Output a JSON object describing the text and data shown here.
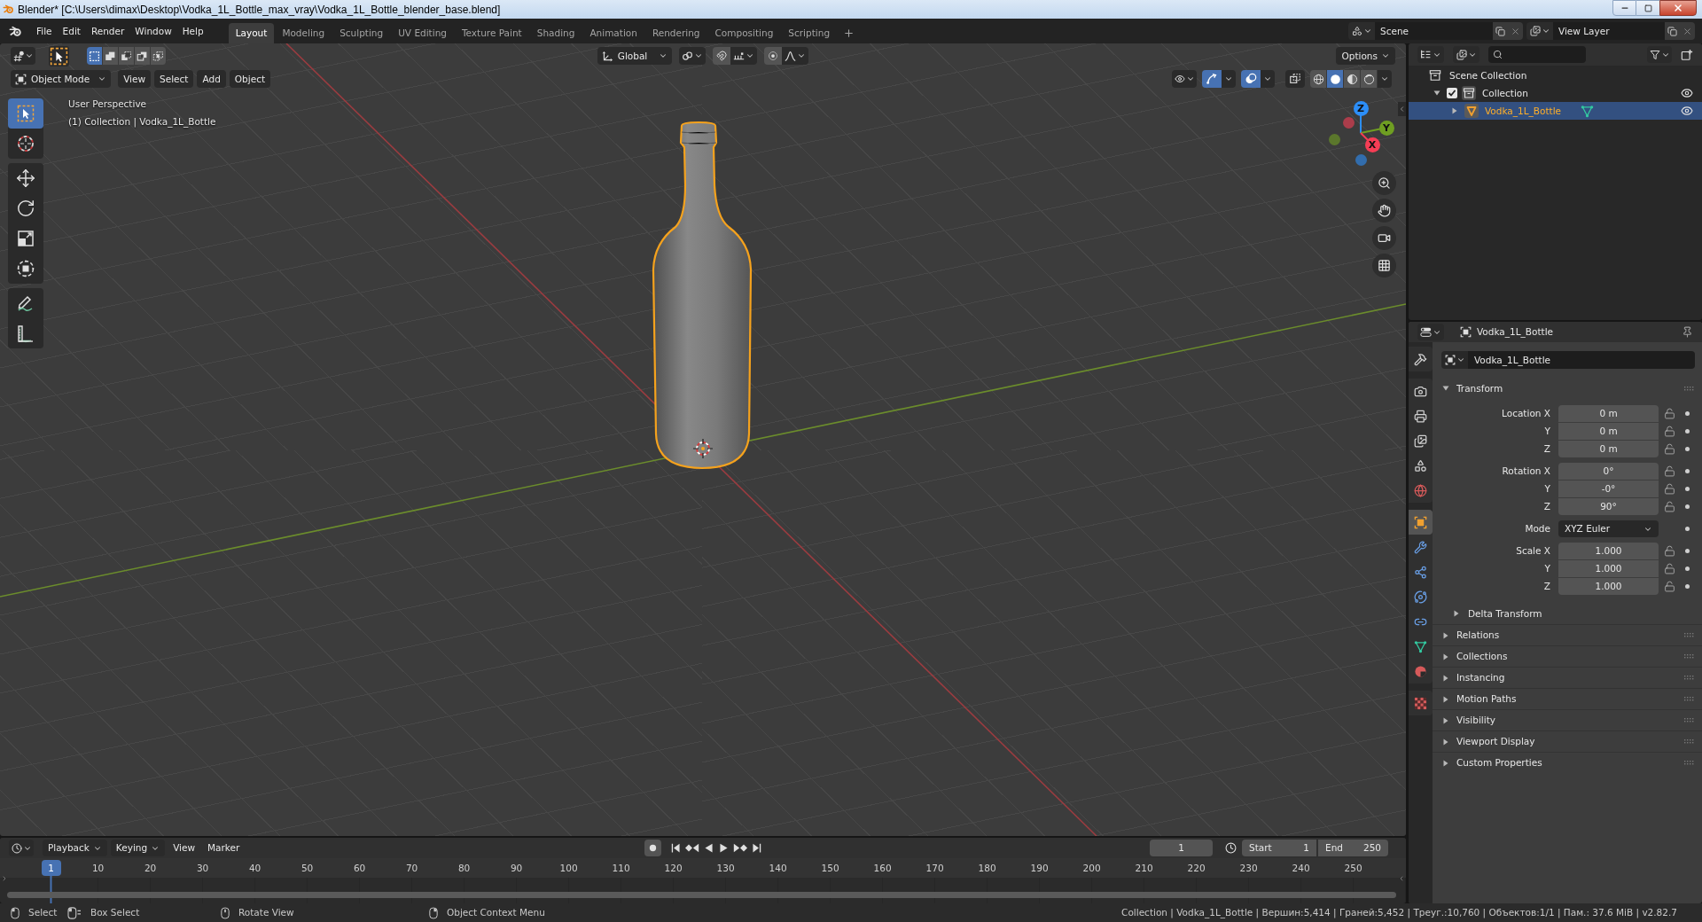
{
  "window": {
    "title": "Blender* [C:\\Users\\dimax\\Desktop\\Vodka_1L_Bottle_max_vray\\Vodka_1L_Bottle_blender_base.blend]"
  },
  "top_bar": {
    "menus": [
      "File",
      "Edit",
      "Render",
      "Window",
      "Help"
    ],
    "workspaces": [
      {
        "label": "Layout",
        "selected": true
      },
      {
        "label": "Modeling",
        "selected": false
      },
      {
        "label": "Sculpting",
        "selected": false
      },
      {
        "label": "UV Editing",
        "selected": false
      },
      {
        "label": "Texture Paint",
        "selected": false
      },
      {
        "label": "Shading",
        "selected": false
      },
      {
        "label": "Animation",
        "selected": false
      },
      {
        "label": "Rendering",
        "selected": false
      },
      {
        "label": "Compositing",
        "selected": false
      },
      {
        "label": "Scripting",
        "selected": false
      }
    ],
    "scene": "Scene",
    "view_layer": "View Layer"
  },
  "viewport": {
    "tool_header": {
      "select_modes": [
        {
          "kind": "set",
          "selected": true
        },
        {
          "kind": "extend",
          "selected": false
        },
        {
          "kind": "subtract",
          "selected": false
        },
        {
          "kind": "invert",
          "selected": false
        },
        {
          "kind": "intersect",
          "selected": false
        }
      ],
      "orientation": "Global",
      "options": "Options"
    },
    "header": {
      "mode": "Object Mode",
      "menus": [
        "View",
        "Select",
        "Add",
        "Object"
      ],
      "toggles": [
        {
          "kind": "gizmo",
          "on": true
        },
        {
          "kind": "overlay",
          "on": true
        },
        {
          "kind": "xray",
          "on": false
        }
      ],
      "shading": [
        {
          "kind": "wireframe",
          "selected": false
        },
        {
          "kind": "solid",
          "selected": true
        },
        {
          "kind": "material",
          "selected": false
        },
        {
          "kind": "rendered",
          "selected": false
        }
      ]
    },
    "tool_groups": [
      {
        "tools": [
          {
            "kind": "select_box",
            "selected": true
          },
          {
            "kind": "cursor",
            "selected": false
          }
        ]
      },
      {
        "tools": [
          {
            "kind": "move",
            "selected": false
          },
          {
            "kind": "rotate",
            "selected": false
          },
          {
            "kind": "scale",
            "selected": false
          },
          {
            "kind": "transform",
            "selected": false
          }
        ]
      },
      {
        "tools": [
          {
            "kind": "annotate",
            "selected": false
          },
          {
            "kind": "measure",
            "selected": false
          }
        ]
      }
    ],
    "info": [
      "User Perspective",
      "(1) Collection | Vodka_1L_Bottle"
    ],
    "axes": [
      {
        "label": "Z",
        "color": "#2c8ef8"
      },
      {
        "label": "Y",
        "color": "#6f9e22"
      },
      {
        "label": "X",
        "color": "#f53d55"
      }
    ],
    "object": {
      "selected": true
    }
  },
  "outliner": {
    "tree": [
      {
        "kind": "scene_collection",
        "label": "Scene Collection",
        "selected": false,
        "children": [
          {
            "kind": "collection",
            "label": "Collection",
            "selected": false,
            "expanded": true,
            "checked": true,
            "visible": true,
            "children": [
              {
                "kind": "object",
                "label": "Vodka_1L_Bottle",
                "selected": true,
                "expanded": false,
                "visible": true
              }
            ]
          }
        ]
      }
    ]
  },
  "properties": {
    "title": "Vodka_1L_Bottle",
    "tab_groups": [
      {
        "tabs": [
          {
            "kind": "tool",
            "selected": false
          }
        ]
      },
      {
        "tabs": [
          {
            "kind": "render",
            "selected": false
          },
          {
            "kind": "output",
            "selected": false
          },
          {
            "kind": "view_layer",
            "selected": false
          },
          {
            "kind": "scene",
            "selected": false
          },
          {
            "kind": "world",
            "selected": false
          }
        ]
      },
      {
        "tabs": [
          {
            "kind": "object",
            "selected": true
          },
          {
            "kind": "modifiers",
            "selected": false
          },
          {
            "kind": "particles",
            "selected": false
          },
          {
            "kind": "physics",
            "selected": false
          },
          {
            "kind": "constraints",
            "selected": false
          },
          {
            "kind": "data",
            "selected": false
          },
          {
            "kind": "material",
            "selected": false
          }
        ]
      },
      {
        "tabs": [
          {
            "kind": "texture",
            "selected": false
          }
        ]
      }
    ],
    "name": "Vodka_1L_Bottle",
    "transform": {
      "title": "Transform",
      "expanded": true,
      "groups": [
        {
          "rows": [
            {
              "kind": "number",
              "label": "Location X",
              "value": "0 m"
            },
            {
              "kind": "number",
              "label": "Y",
              "value": "0 m"
            },
            {
              "kind": "number",
              "label": "Z",
              "value": "0 m"
            }
          ]
        },
        {
          "rows": [
            {
              "kind": "number",
              "label": "Rotation X",
              "value": "0°"
            },
            {
              "kind": "number",
              "label": "Y",
              "value": "-0°"
            },
            {
              "kind": "number",
              "label": "Z",
              "value": "90°"
            }
          ]
        },
        {
          "rows": [
            {
              "kind": "dropdown",
              "label": "Mode",
              "value": "XYZ Euler"
            }
          ]
        },
        {
          "rows": [
            {
              "kind": "number",
              "label": "Scale X",
              "value": "1.000"
            },
            {
              "kind": "number",
              "label": "Y",
              "value": "1.000"
            },
            {
              "kind": "number",
              "label": "Z",
              "value": "1.000"
            }
          ]
        }
      ],
      "subpanels": [
        {
          "title": "Delta Transform",
          "expanded": false
        }
      ]
    },
    "panels": [
      {
        "title": "Relations",
        "expanded": false
      },
      {
        "title": "Collections",
        "expanded": false
      },
      {
        "title": "Instancing",
        "expanded": false
      },
      {
        "title": "Motion Paths",
        "expanded": false
      },
      {
        "title": "Visibility",
        "expanded": false
      },
      {
        "title": "Viewport Display",
        "expanded": false
      },
      {
        "title": "Custom Properties",
        "expanded": false
      }
    ]
  },
  "timeline": {
    "menus": [
      {
        "kind": "dropdown",
        "label": "Playback"
      },
      {
        "kind": "dropdown",
        "label": "Keying"
      },
      {
        "kind": "menu",
        "label": "View"
      },
      {
        "kind": "menu",
        "label": "Marker"
      }
    ],
    "current_frame": "1",
    "start": {
      "label": "Start",
      "value": "1"
    },
    "end": {
      "label": "End",
      "value": "250"
    },
    "playhead": "1",
    "ruler": [
      "10",
      "20",
      "30",
      "40",
      "50",
      "60",
      "70",
      "80",
      "90",
      "100",
      "110",
      "120",
      "130",
      "140",
      "150",
      "160",
      "170",
      "180",
      "190",
      "200",
      "210",
      "220",
      "230",
      "240",
      "250"
    ]
  },
  "status_bar": {
    "hints": [
      {
        "kind": "left_click",
        "text": "Select"
      },
      {
        "kind": "left_drag",
        "text": "Box Select"
      },
      {
        "kind": "middle_click",
        "text": "Rotate View"
      },
      {
        "kind": "right_click",
        "text": "Object Context Menu"
      }
    ],
    "stats": "Collection | Vodka_1L_Bottle | Вершин:5,414 | Граней:5,452 | Треуг.:10,760 | Объектов:1/1 | Пам.: 37.6 MiB | v2.82.7"
  }
}
